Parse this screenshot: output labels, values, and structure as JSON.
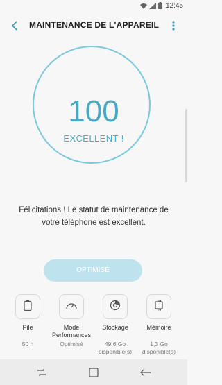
{
  "status_bar": {
    "time": "12:45",
    "icons": [
      "wifi-icon",
      "signal-icon",
      "battery-icon"
    ]
  },
  "app_bar": {
    "title": "MAINTENANCE DE L'APPAREIL",
    "icons": [
      "back-arrow-icon",
      "more-vert-icon"
    ]
  },
  "score": {
    "value": "100",
    "label": "EXCELLENT !",
    "color": "#48a9c5"
  },
  "message": "Félicitations ! Le statut de maintenance de votre téléphone est excellent.",
  "optimise_button": {
    "label": "OPTIMISÉ",
    "color": "#bfe3ee"
  },
  "tiles": [
    {
      "icon": "battery-icon",
      "label": "Pile",
      "value": "50 h"
    },
    {
      "icon": "speedometer-icon",
      "label": "Mode Performances",
      "value": "Optimisé"
    },
    {
      "icon": "storage-icon",
      "label": "Stockage",
      "value": "49,6 Go disponible(s)"
    },
    {
      "icon": "memory-chip-icon",
      "label": "Mémoire",
      "value": "1,3 Go disponible(s)"
    }
  ],
  "nav_bar": {
    "icons": [
      "recent-apps-icon",
      "home-icon",
      "back-icon"
    ]
  }
}
